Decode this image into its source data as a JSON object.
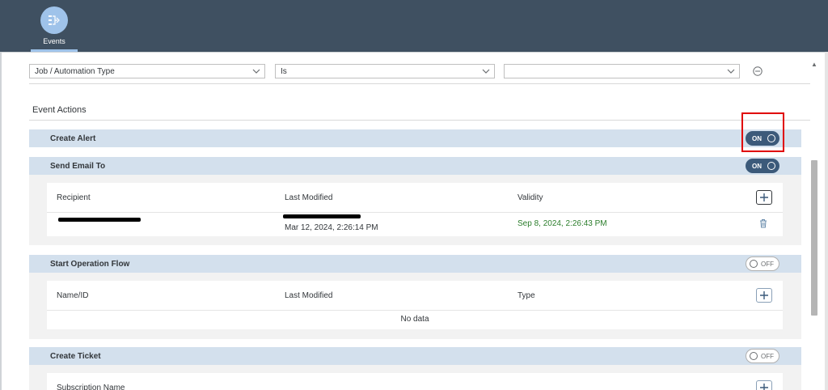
{
  "nav": {
    "events_label": "Events",
    "events_icon": "flow-tree-icon"
  },
  "filter": {
    "field_value": "Job / Automation Type",
    "operator_value": "Is",
    "value_value": ""
  },
  "event_actions": {
    "heading": "Event Actions",
    "create_alert": {
      "title": "Create Alert",
      "toggle": "ON"
    },
    "send_email": {
      "title": "Send Email To",
      "toggle": "ON",
      "columns": [
        "Recipient",
        "Last Modified",
        "Validity"
      ],
      "rows": [
        {
          "recipient": "[redacted]",
          "last_modified": "Mar 12, 2024, 2:26:14 PM",
          "validity": "Sep 8, 2024, 2:26:43 PM"
        }
      ]
    },
    "start_operation_flow": {
      "title": "Start Operation Flow",
      "toggle": "OFF",
      "columns": [
        "Name/ID",
        "Last Modified",
        "Type"
      ],
      "empty_text": "No data"
    },
    "create_ticket": {
      "title": "Create Ticket",
      "toggle": "OFF",
      "columns": [
        "Subscription Name"
      ]
    }
  },
  "colors": {
    "topbar": "#3f5061",
    "panel_header": "#d3e0ed",
    "toggle_on": "#3c5a7a",
    "validity_text": "#2b7d2b",
    "highlight": "#e00000"
  }
}
